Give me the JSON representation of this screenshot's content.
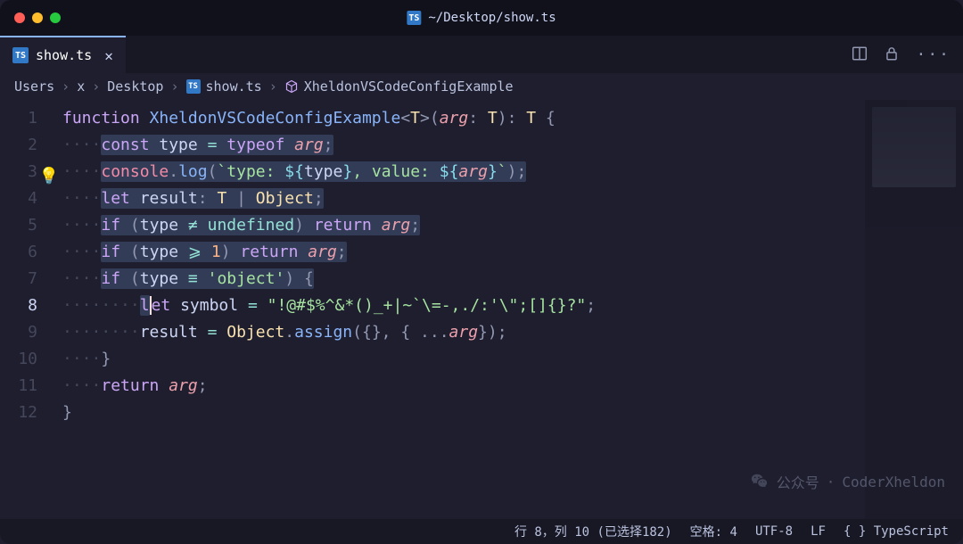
{
  "titlebar": {
    "path": "~/Desktop/show.ts"
  },
  "tab": {
    "filename": "show.ts",
    "icon_label": "TS"
  },
  "icons": {
    "split": "split-panel-icon",
    "lock": "lock-icon",
    "more": "more-icon"
  },
  "breadcrumb": {
    "seg1": "Users",
    "seg2": "x",
    "seg3": "Desktop",
    "file": "show.ts",
    "symbol": "XheldonVSCodeConfigExample"
  },
  "code": {
    "line_numbers": [
      "1",
      "2",
      "3",
      "4",
      "5",
      "6",
      "7",
      "8",
      "9",
      "10",
      "11",
      "12"
    ],
    "lightbulb_line": 3,
    "current_line": 8,
    "l1": {
      "kw": "function",
      "name": "XheldonVSCodeConfigExample",
      "g1": "<",
      "tp": "T",
      "g2": ">(",
      "arg": "arg",
      "col": ": ",
      "tp2": "T",
      "cp": "): ",
      "tp3": "T",
      "ob": " {"
    },
    "l2": {
      "ws": "····",
      "kw": "const",
      "v": " type ",
      "eq": "=",
      "sp": " ",
      "to": "typeof",
      "sp2": " ",
      "arg": "arg",
      "sc": ";"
    },
    "l3": {
      "ws": "····",
      "obj": "console",
      "dot": ".",
      "fn": "log",
      "op": "(",
      "bt": "`",
      "t1": "type: ",
      "d1": "${",
      "v1": "type",
      "d2": "}",
      "t2": ", value: ",
      "d3": "${",
      "v2": "arg",
      "d4": "}",
      "bt2": "`",
      "cp": ");"
    },
    "l4": {
      "ws": "····",
      "kw": "let",
      "sp": " ",
      "v": "result",
      "col": ": ",
      "tp": "T",
      "pipe": " | ",
      "obj": "Object",
      "sc": ";"
    },
    "l5": {
      "ws": "····",
      "kw": "if",
      "op": " (",
      "v": "type ",
      "neq": "≠",
      "sp": " ",
      "u": "undefined",
      "cp": ") ",
      "ret": "return",
      "sp2": " ",
      "arg": "arg",
      "sc": ";"
    },
    "l6": {
      "ws": "····",
      "kw": "if",
      "op": " (",
      "v": "type ",
      "ge": "⩾",
      "sp": " ",
      "n": "1",
      "cp": ") ",
      "ret": "return",
      "sp2": " ",
      "arg": "arg",
      "sc": ";"
    },
    "l7": {
      "ws": "····",
      "kw": "if",
      "op": " (",
      "v": "type ",
      "eq": "≡",
      "sp": " ",
      "s": "'object'",
      "cp": ") {"
    },
    "l8": {
      "ws": "········",
      "kw": "let",
      "sp": " ",
      "v": "symbol",
      "eq": " = ",
      "s": "\"!@#$%^&*()_+|~`\\=-,./:'\\\";[]{}?\"",
      "sc": ";"
    },
    "l9": {
      "ws": "········",
      "v": "result",
      "eq": " = ",
      "obj": "Object",
      "dot": ".",
      "fn": "assign",
      "op": "({}, { ...",
      "arg": "arg",
      "cp": "});"
    },
    "l10": {
      "ws": "····",
      "br": "}"
    },
    "l11": {
      "ws": "····",
      "ret": "return",
      "sp": " ",
      "arg": "arg",
      "sc": ";"
    },
    "l12": {
      "br": "}"
    }
  },
  "statusbar": {
    "position": "行 8，列 10 (已选择182)",
    "spaces": "空格: 4",
    "encoding": "UTF-8",
    "eol": "LF",
    "lang_icon": "{ }",
    "lang": "TypeScript"
  },
  "watermark": {
    "label": "公众号",
    "sep": "·",
    "name": "CoderXheldon"
  }
}
